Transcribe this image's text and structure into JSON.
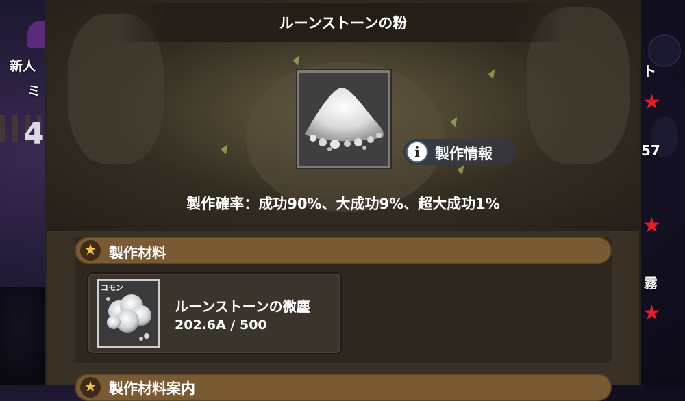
{
  "background": {
    "left_texts": [
      "新人",
      "ミ"
    ],
    "left_number": "4",
    "right_texts": [
      "ト",
      "57",
      "霧"
    ]
  },
  "panel": {
    "title": "ルーンストーンの粉",
    "info_button_label": "製作情報",
    "info_icon": "info-icon",
    "craft_rate": "製作確率：成功90%、大成功9%、超大成功1%"
  },
  "materials_section": {
    "label": "製作材料",
    "icon": "star-icon",
    "items": [
      {
        "rarity": "コモン",
        "name": "ルーンストーンの微塵",
        "count": "202.6A / 500"
      }
    ]
  },
  "next_section": {
    "label": "製作材料案内"
  },
  "colors": {
    "panel_bg": "#3a3126",
    "section_header": "#7a5a33",
    "star": "#f6c445",
    "accent_red": "#e01e2a"
  }
}
